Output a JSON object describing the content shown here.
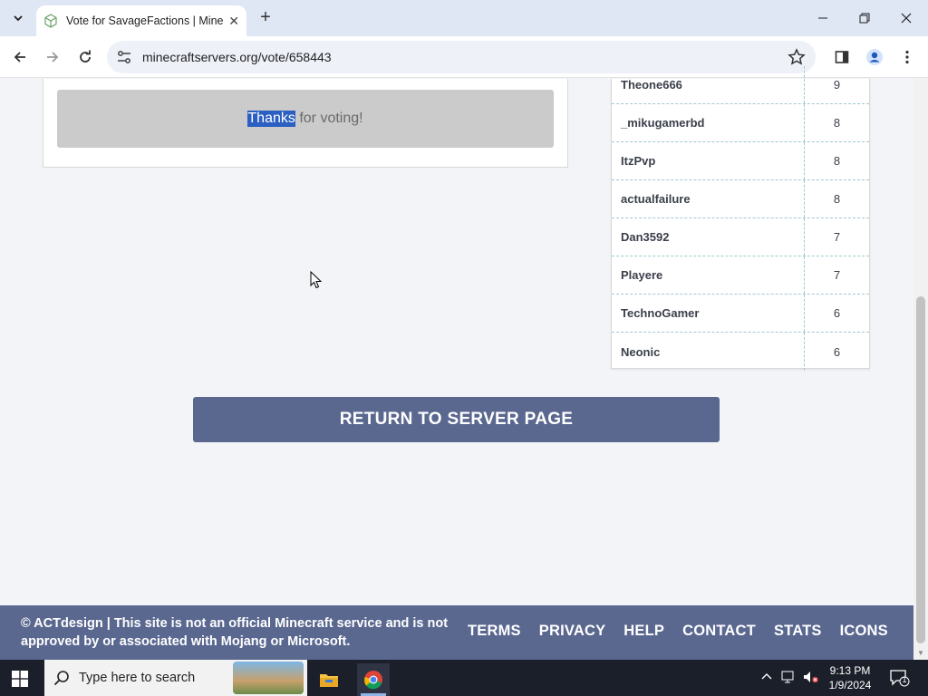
{
  "browser": {
    "tab_title": "Vote for SavageFactions | Minec",
    "url": "minecraftservers.org/vote/658443"
  },
  "vote_card": {
    "thanks_highlight": "Thanks",
    "thanks_rest": " for voting!"
  },
  "voters": [
    {
      "name": "Theone666",
      "votes": "9"
    },
    {
      "name": "_mikugamerbd",
      "votes": "8"
    },
    {
      "name": "ItzPvp",
      "votes": "8"
    },
    {
      "name": "actualfailure",
      "votes": "8"
    },
    {
      "name": "Dan3592",
      "votes": "7"
    },
    {
      "name": "Playere",
      "votes": "7"
    },
    {
      "name": "TechnoGamer",
      "votes": "6"
    },
    {
      "name": "Neonic",
      "votes": "6"
    }
  ],
  "return_button": "RETURN TO SERVER PAGE",
  "footer": {
    "copyright": "© ACTdesign | This site is not an official Minecraft service and is not approved by or associated with Mojang or Microsoft.",
    "links": [
      "TERMS",
      "PRIVACY",
      "HELP",
      "CONTACT",
      "STATS",
      "ICONS"
    ]
  },
  "taskbar": {
    "search_placeholder": "Type here to search",
    "time": "9:13 PM",
    "date": "1/9/2024",
    "notification_count": "1"
  },
  "colors": {
    "accent": "#5a6890",
    "highlight": "#2b5fc1",
    "dashed_border": "#9fc9cf"
  }
}
